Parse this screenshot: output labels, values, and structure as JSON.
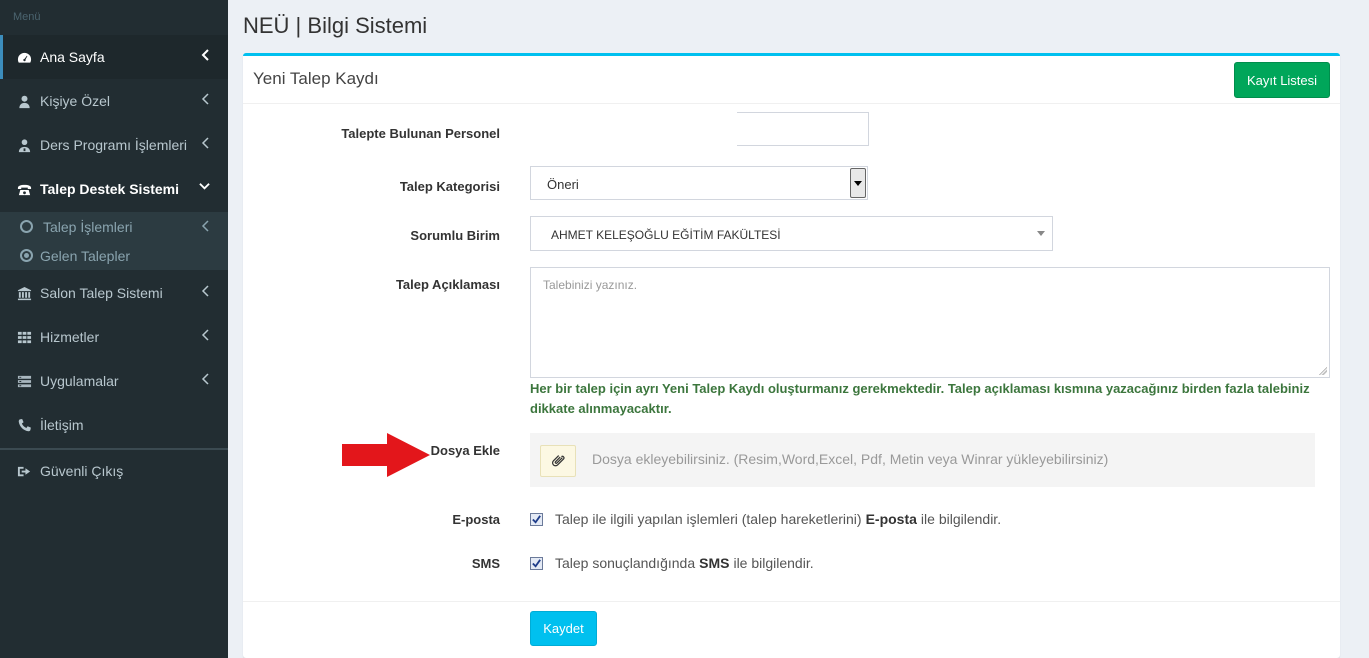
{
  "sidebar": {
    "menu_header": "Menü",
    "items": [
      {
        "label": "Ana Sayfa"
      },
      {
        "label": "Kişiye Özel"
      },
      {
        "label": "Ders Programı İşlemleri"
      },
      {
        "label": "Talep Destek Sistemi"
      },
      {
        "label": "Salon Talep Sistemi"
      },
      {
        "label": "Hizmetler"
      },
      {
        "label": "Uygulamalar"
      },
      {
        "label": "İletişim"
      },
      {
        "label": "Güvenli Çıkış"
      }
    ],
    "submenu": [
      {
        "label": "Talep İşlemleri"
      },
      {
        "label": "Gelen Talepler"
      }
    ]
  },
  "header": {
    "title": "NEÜ | Bilgi Sistemi"
  },
  "box": {
    "title": "Yeni Talep Kaydı",
    "list_button": "Kayıt Listesi"
  },
  "form": {
    "personnel_label": "Talepte Bulunan Personel",
    "category_label": "Talep Kategorisi",
    "category_value": "Öneri",
    "unit_label": "Sorumlu Birim",
    "unit_value": "AHMET KELEŞOĞLU EĞİTİM FAKÜLTESİ",
    "description_label": "Talep Açıklaması",
    "description_placeholder": "Talebinizi yazınız.",
    "help_text": "Her bir talep için ayrı Yeni Talep Kaydı oluşturmanız gerekmektedir. Talep açıklaması kısmına yazacağınız birden fazla talebiniz dikkate alınmayacaktır.",
    "file_label": "Dosya Ekle",
    "file_text": "Dosya ekleyebilirsiniz. (Resim,Word,Excel, Pdf, Metin veya Winrar yükleyebilirsiniz)",
    "email_label": "E-posta",
    "email_text_before": "Talep ile ilgili yapılan işlemleri (talep hareketlerini)",
    "email_bold": "E-posta",
    "email_text_after": "ile bilgilendir.",
    "email_checked": true,
    "sms_label": "SMS",
    "sms_text_before": "Talep sonuçlandığında",
    "sms_bold": "SMS",
    "sms_text_after": "ile bilgilendir.",
    "sms_checked": true,
    "save_button": "Kaydet"
  },
  "colors": {
    "sidebar_bg": "#222d32",
    "accent": "#00c0ef",
    "success": "#00a65a",
    "help_text": "#3c763d",
    "annotation_arrow": "#e3161b"
  }
}
